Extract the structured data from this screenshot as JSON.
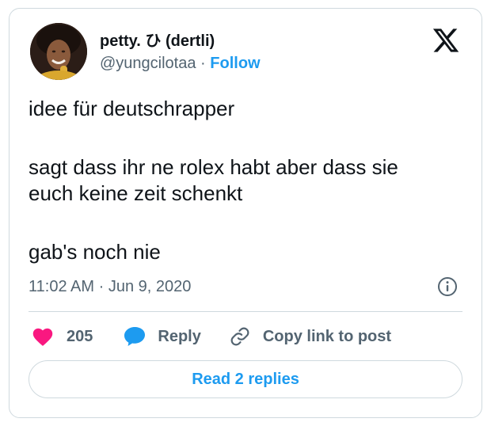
{
  "author": {
    "name": "petty. ひ (dertli)",
    "handle": "@yungcilotaa",
    "separator": "·",
    "follow_label": "Follow"
  },
  "tweet": {
    "paragraphs": [
      [
        "idee für deutschrapper"
      ],
      [
        "sagt dass ihr ne rolex habt aber dass sie",
        "euch keine zeit schenkt"
      ],
      [
        "gab's noch nie"
      ]
    ],
    "time": "11:02 AM",
    "date_separator": "·",
    "date": "Jun 9, 2020"
  },
  "actions": {
    "like_count": "205",
    "reply_label": "Reply",
    "copy_label": "Copy link to post"
  },
  "read_replies_label": "Read 2 replies",
  "icons": {
    "logo": "x-logo-icon",
    "info": "info-icon",
    "like": "heart-icon",
    "reply": "speech-bubble-icon",
    "copy": "link-icon"
  },
  "colors": {
    "accent": "#1d9bf0",
    "like": "#f91880",
    "text": "#0f1419",
    "muted": "#536471",
    "border": "#cfd9de"
  }
}
